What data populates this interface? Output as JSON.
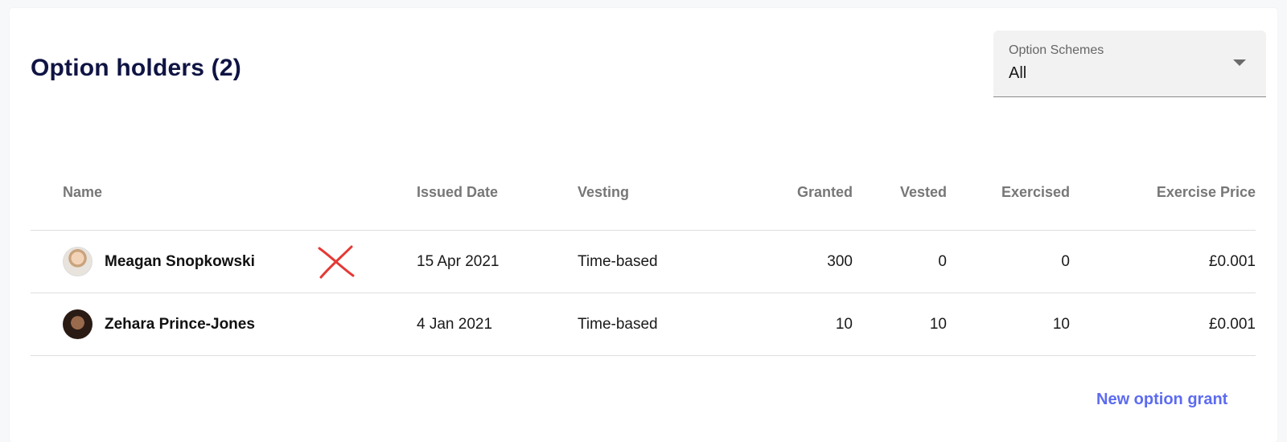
{
  "page": {
    "title": "Option holders (2)"
  },
  "filter": {
    "label": "Option Schemes",
    "value": "All",
    "icon": "arrow-drop-down-icon"
  },
  "table": {
    "columns": [
      "Name",
      "Issued Date",
      "Vesting",
      "Granted",
      "Vested",
      "Exercised",
      "Exercise Price"
    ],
    "rows": [
      {
        "name": "Meagan Snopkowski",
        "issued_date": "15 Apr 2021",
        "vesting": "Time-based",
        "granted": "300",
        "vested": "0",
        "exercised": "0",
        "exercise_price": "£0.001",
        "annotation": "red-x-mark-icon"
      },
      {
        "name": "Zehara Prince-Jones",
        "issued_date": "4 Jan 2021",
        "vesting": "Time-based",
        "granted": "10",
        "vested": "10",
        "exercised": "10",
        "exercise_price": "£0.001"
      }
    ]
  },
  "actions": {
    "new_grant_label": "New option grant"
  },
  "colors": {
    "title": "#0f1443",
    "accent_link": "#5c6bf0",
    "annotation_red": "#e53935"
  }
}
